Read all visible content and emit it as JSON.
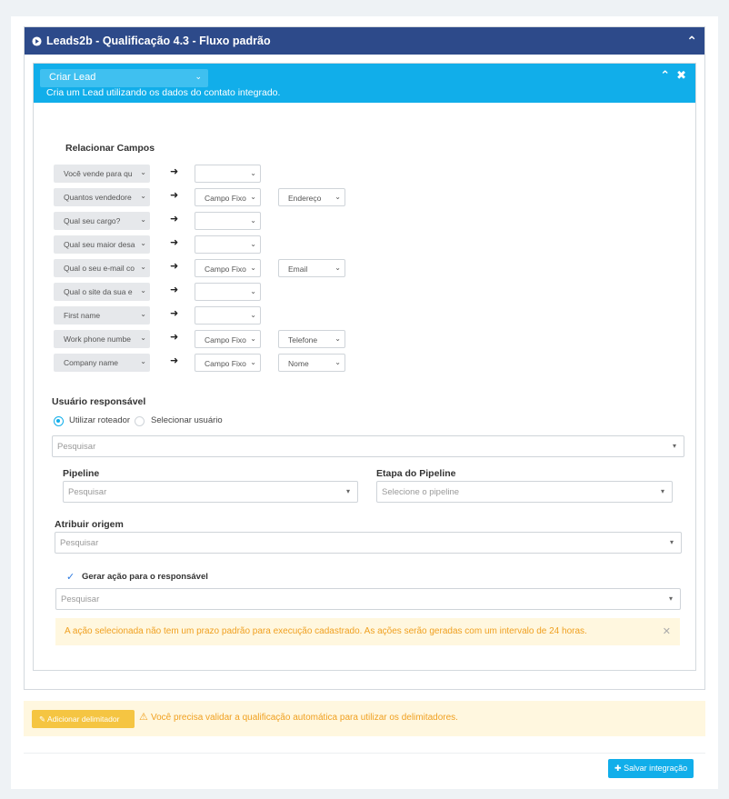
{
  "panel": {
    "title": "Leads2b - Qualificação 4.3 - Fluxo padrão"
  },
  "action": {
    "selected": "Criar Lead",
    "description": "Cria um Lead utilizando os dados do contato integrado."
  },
  "mapping": {
    "title": "Relacionar Campos",
    "rows": [
      {
        "source": "Você vende para qu",
        "target": "",
        "extra": null
      },
      {
        "source": "Quantos vendedore",
        "target": "Campo Fixo",
        "extra": "Endereço"
      },
      {
        "source": "Qual seu cargo?",
        "target": "",
        "extra": null
      },
      {
        "source": "Qual seu maior desa",
        "target": "",
        "extra": null
      },
      {
        "source": "Qual o seu e-mail co",
        "target": "Campo Fixo",
        "extra": "Email"
      },
      {
        "source": "Qual o site da sua e",
        "target": "",
        "extra": null
      },
      {
        "source": "First name",
        "target": "",
        "extra": null
      },
      {
        "source": "Work phone numbe",
        "target": "Campo Fixo",
        "extra": "Telefone"
      },
      {
        "source": "Company name",
        "target": "Campo Fixo",
        "extra": "Nome"
      }
    ]
  },
  "responsible": {
    "title": "Usuário responsável",
    "option_router": "Utilizar roteador",
    "option_select": "Selecionar usuário",
    "search_placeholder": "Pesquisar"
  },
  "pipeline": {
    "label": "Pipeline",
    "placeholder": "Pesquisar"
  },
  "stage": {
    "label": "Etapa do Pipeline",
    "placeholder": "Selecione o pipeline"
  },
  "origin": {
    "label": "Atribuir origem",
    "placeholder": "Pesquisar"
  },
  "generate_action": {
    "label": "Gerar ação para o responsável",
    "placeholder": "Pesquisar"
  },
  "alert": {
    "text": "A ação selecionada não tem um prazo padrão para execução cadastrado. As ações serão geradas com um intervalo de 24 horas."
  },
  "footer": {
    "delimiter_button": "Adicionar delimitador",
    "warning": "Você precisa validar a qualificação automática para utilizar os delimitadores.",
    "save_button": "Salvar integração"
  },
  "icons": {
    "collapse": "chevron-up-icon",
    "close": "close-icon",
    "play": "play-circle-icon",
    "arrow": "arrow-right-icon",
    "warning": "warning-icon",
    "pencil": "pencil-icon",
    "plus": "plus-icon",
    "check": "check-icon"
  },
  "colors": {
    "header_dark": "#2d4a8a",
    "header_light": "#11aeea",
    "warning": "#f0a020",
    "alert_bg": "#fff7df"
  }
}
